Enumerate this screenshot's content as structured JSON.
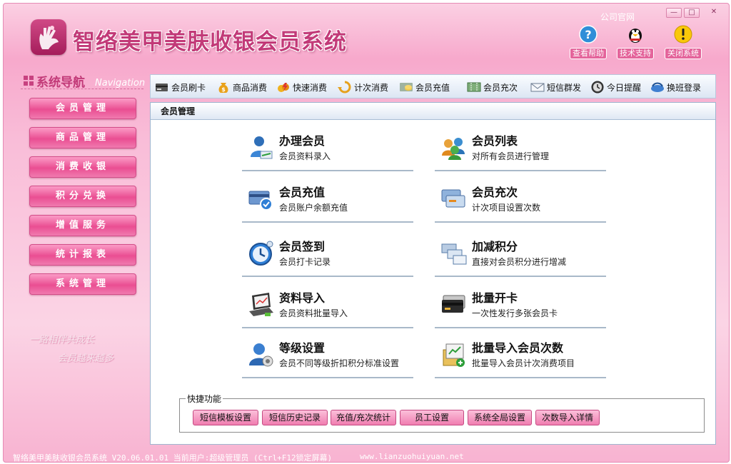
{
  "app": {
    "title": "智络美甲美肤收银会员系统",
    "official_site": "公司官网",
    "window_controls": [
      "—",
      "□",
      "✕"
    ]
  },
  "header_buttons": [
    {
      "label": "查看帮助",
      "icon": "help-icon"
    },
    {
      "label": "技术支持",
      "icon": "penguin-icon"
    },
    {
      "label": "关闭系统",
      "icon": "warning-icon"
    }
  ],
  "sidebar": {
    "title": "系统导航",
    "title_en": "Navigation",
    "items": [
      "会员管理",
      "商品管理",
      "消费收银",
      "积分兑换",
      "增值服务",
      "统计报表",
      "系统管理"
    ],
    "slogan_line1": "一路相伴共成长",
    "slogan_line2": "会员越来越多"
  },
  "toolbar": {
    "items": [
      {
        "label": "会员刷卡",
        "icon": "card-swipe-icon"
      },
      {
        "label": "商品消费",
        "icon": "money-bag-icon"
      },
      {
        "label": "快速消费",
        "icon": "fast-pay-icon"
      },
      {
        "label": "计次消费",
        "icon": "refresh-icon"
      },
      {
        "label": "会员充值",
        "icon": "recharge-icon"
      },
      {
        "label": "会员充次",
        "icon": "ticket-icon"
      },
      {
        "label": "短信群发",
        "icon": "sms-icon"
      },
      {
        "label": "今日提醒",
        "icon": "clock-icon"
      },
      {
        "label": "换班登录",
        "icon": "shift-login-icon"
      }
    ]
  },
  "panel": {
    "title": "会员管理",
    "functions": [
      {
        "name": "办理会员",
        "desc": "会员资料录入",
        "icon": "member-add-icon"
      },
      {
        "name": "会员列表",
        "desc": "对所有会员进行管理",
        "icon": "member-list-icon"
      },
      {
        "name": "会员充值",
        "desc": "会员账户余额充值",
        "icon": "member-recharge-icon"
      },
      {
        "name": "会员充次",
        "desc": "计次项目设置次数",
        "icon": "member-count-icon"
      },
      {
        "name": "会员签到",
        "desc": "会员打卡记录",
        "icon": "checkin-clock-icon"
      },
      {
        "name": "加减积分",
        "desc": "直接对会员积分进行增减",
        "icon": "points-icon"
      },
      {
        "name": "资料导入",
        "desc": "会员资料批量导入",
        "icon": "laptop-import-icon"
      },
      {
        "name": "批量开卡",
        "desc": "一次性发行多张会员卡",
        "icon": "batch-card-icon"
      },
      {
        "name": "等级设置",
        "desc": "会员不同等级折扣积分标准设置",
        "icon": "level-user-icon"
      },
      {
        "name": "批量导入会员次数",
        "desc": "批量导入会员计次消费项目",
        "icon": "batch-import-icon"
      }
    ],
    "quick": {
      "title": "快捷功能",
      "buttons": [
        "短信模板设置",
        "短信历史记录",
        "充值/充次统计",
        "员工设置",
        "系统全局设置",
        "次数导入详情"
      ]
    }
  },
  "status": {
    "text": "智络美甲美肤收银会员系统 V20.06.01.01 当前用户:超级管理员 (Ctrl+F12锁定屏幕)",
    "site": "www.lianzuohuiyuan.net"
  },
  "colors": {
    "accent": "#e4649b",
    "brand": "#c23a78",
    "panel_border": "#9fb6d0"
  }
}
